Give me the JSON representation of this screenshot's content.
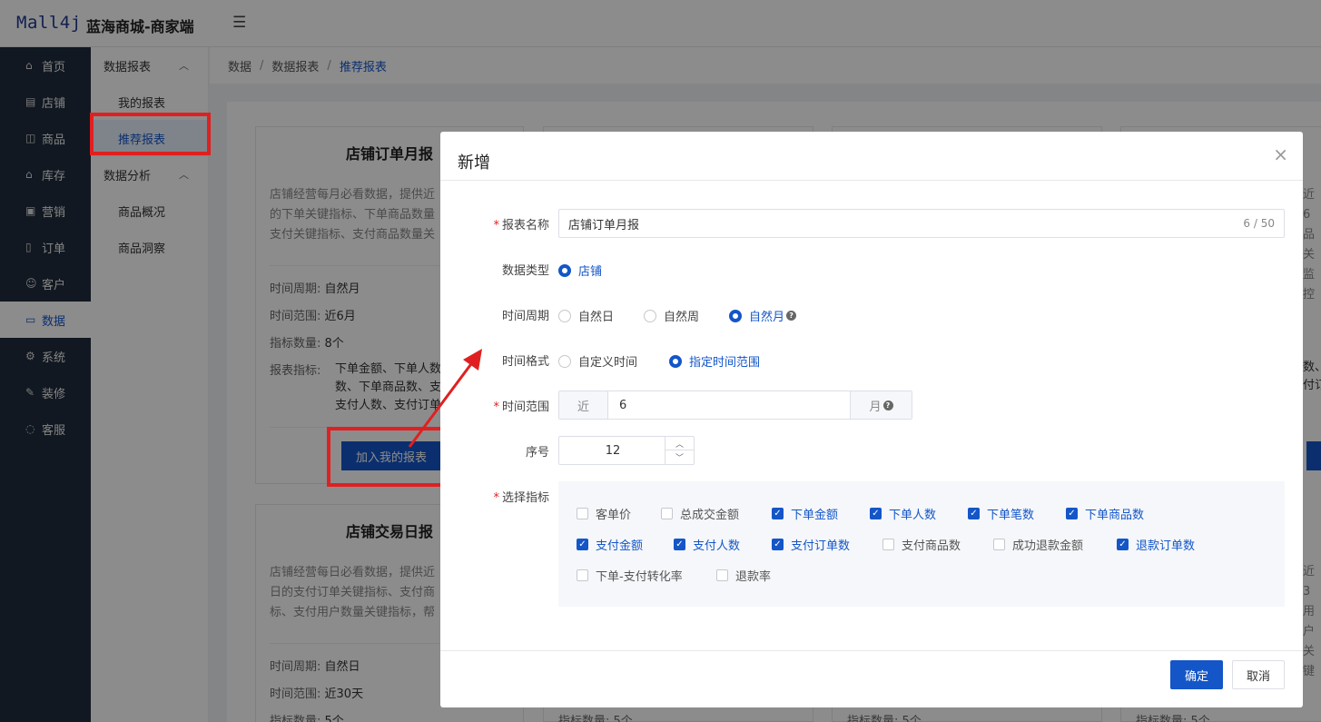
{
  "header": {
    "logo": "Mall4j",
    "shop_name": "蓝海商城-商家端",
    "collapse_icon": "menu-fold-icon"
  },
  "sidebar": {
    "items": [
      {
        "label": "首页",
        "icon": "home-icon"
      },
      {
        "label": "店铺",
        "icon": "shop-icon"
      },
      {
        "label": "商品",
        "icon": "bag-icon"
      },
      {
        "label": "库存",
        "icon": "warehouse-icon"
      },
      {
        "label": "营销",
        "icon": "gift-icon"
      },
      {
        "label": "订单",
        "icon": "order-icon"
      },
      {
        "label": "客户",
        "icon": "users-icon"
      },
      {
        "label": "数据",
        "icon": "chart-icon",
        "active": true
      },
      {
        "label": "系统",
        "icon": "gear-icon"
      },
      {
        "label": "装修",
        "icon": "decorate-icon"
      },
      {
        "label": "客服",
        "icon": "chat-icon"
      }
    ]
  },
  "submenu": {
    "group1": "数据报表",
    "group1_items": [
      "我的报表",
      "推荐报表"
    ],
    "group2": "数据分析",
    "group2_items": [
      "商品概况",
      "商品洞察"
    ]
  },
  "breadcrumb": [
    "数据",
    "数据报表",
    "推荐报表"
  ],
  "cards": [
    {
      "title": "店铺订单月报",
      "desc": [
        "店铺经营每月必看数据，提供近",
        "的下单关键指标、下单商品数量",
        "支付关键指标、支付商品数量关"
      ],
      "period_label": "时间周期:",
      "period": "自然月",
      "range_label": "时间范围:",
      "range": "近6月",
      "count_label": "指标数量:",
      "count": "8个",
      "metrics_label": "报表指标:",
      "metrics": [
        "下单金额、下单人数",
        "数、下单商品数、支",
        "支付人数、支付订单"
      ],
      "button": "加入我的报表"
    },
    {
      "title": "店铺交易日报",
      "desc": [
        "店铺经营每日必看数据，提供近",
        "日的支付订单关键指标、支付商",
        "标、支付用户数量关键指标，帮"
      ],
      "period_label": "时间周期:",
      "period": "自然日",
      "range_label": "时间范围:",
      "range": "近30天",
      "count_label": "指标数量:",
      "count": "5个"
    }
  ],
  "bg_fragments": {
    "right_desc": [
      "近6",
      "品关",
      "监控"
    ],
    "right_metrics": [
      "数、",
      "付订"
    ],
    "right_desc2": [
      "近3",
      "用户",
      "关键"
    ],
    "bottom_counts": [
      "指标数量: 5个",
      "指标数量: 5个",
      "指标数量: 5个"
    ]
  },
  "dialog": {
    "title": "新增",
    "close": "×",
    "name_label": "报表名称",
    "name_value": "店铺订单月报",
    "name_counter": "6 / 50",
    "type_label": "数据类型",
    "type_option": "店铺",
    "period_label": "时间周期",
    "period_options": [
      "自然日",
      "自然周",
      "自然月"
    ],
    "period_selected": "自然月",
    "format_label": "时间格式",
    "format_options": [
      "自定义时间",
      "指定时间范围"
    ],
    "format_selected": "指定时间范围",
    "range_label": "时间范围",
    "range_prefix": "近",
    "range_value": "6",
    "range_suffix": "月",
    "seq_label": "序号",
    "seq_value": "12",
    "indicators_label": "选择指标",
    "indicators": [
      {
        "label": "客单价",
        "checked": false
      },
      {
        "label": "总成交金额",
        "checked": false
      },
      {
        "label": "下单金额",
        "checked": true
      },
      {
        "label": "下单人数",
        "checked": true
      },
      {
        "label": "下单笔数",
        "checked": true
      },
      {
        "label": "下单商品数",
        "checked": true
      },
      {
        "label": "支付金额",
        "checked": true
      },
      {
        "label": "支付人数",
        "checked": true
      },
      {
        "label": "支付订单数",
        "checked": true
      },
      {
        "label": "支付商品数",
        "checked": false
      },
      {
        "label": "成功退款金额",
        "checked": false
      },
      {
        "label": "退款订单数",
        "checked": true
      },
      {
        "label": "下单-支付转化率",
        "checked": false
      },
      {
        "label": "退款率",
        "checked": false
      }
    ],
    "ok": "确定",
    "cancel": "取消"
  },
  "colors": {
    "accent": "#1456c8",
    "highlight": "#e02020",
    "sidebar": "#1f2d3d"
  }
}
